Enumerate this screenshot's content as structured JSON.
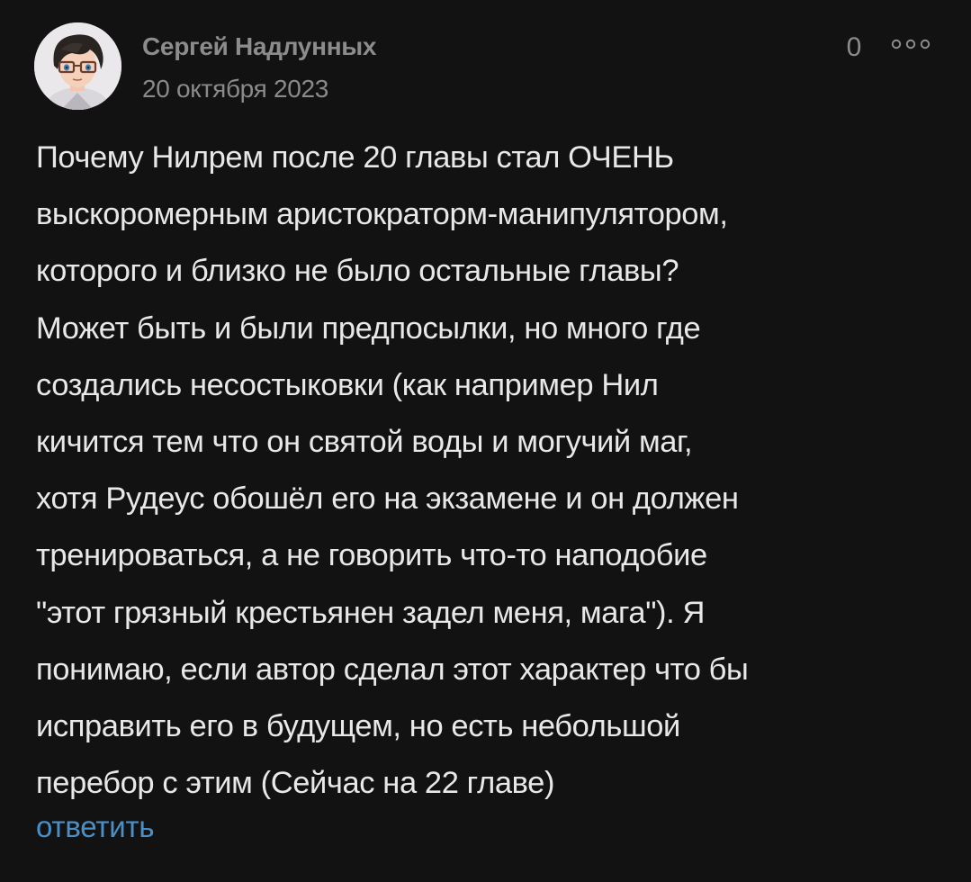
{
  "comment": {
    "author": "Сергей Надлунных",
    "date": "20 октября 2023",
    "rating": "0",
    "text": "Почему Нилрем после 20 главы стал ОЧЕНЬ\nвыскоромерным аристократорм-манипулятором,\nкоторого и близко не было остальные главы?\nМожет быть и были предпосылки, но много где\nсоздались несостыковки (как например Нил\nкичится тем что он святой воды и могучий маг,\nхотя Рудеус обошёл его на экзамене и он должен\nтренироваться, а не говорить что-то наподобие\n\"этот грязный крестьянен задел меня, мага\"). Я\nпонимаю, если автор сделал этот характер что бы\nисправить его в будущем, но есть небольшой\nперебор с этим (Сейчас на 22 главе)",
    "reply_label": "ответить",
    "avatar_icon": "anime-boy-with-glasses-avatar",
    "more_icon": "more-dots-icon"
  },
  "colors": {
    "background": "#121212",
    "text": "#e8e8e8",
    "meta": "#8c8c8c",
    "link": "#4a90c8"
  }
}
